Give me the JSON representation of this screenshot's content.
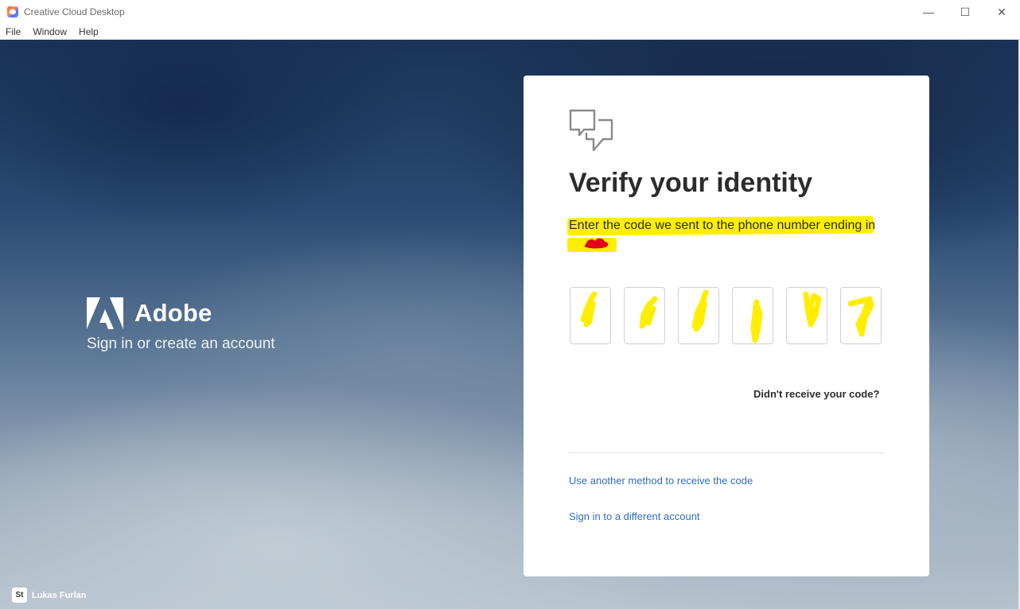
{
  "window": {
    "title": "Creative Cloud Desktop",
    "controls": {
      "minimize": "—",
      "maximize": "☐",
      "close": "✕"
    }
  },
  "menu": [
    "File",
    "Window",
    "Help"
  ],
  "brand": {
    "name": "Adobe",
    "tagline": "Sign in or create an account"
  },
  "user": {
    "badge": "St",
    "name": "Lukas Furlan"
  },
  "card": {
    "icon": "chat-bubbles-icon",
    "title": "Verify your identity",
    "description": "Enter the code we sent to the phone number ending in",
    "code_digits": [
      "",
      "",
      "",
      "",
      "",
      ""
    ],
    "resend_link": "Didn't receive your code?",
    "alt_method_link": "Use another method to receive the code",
    "different_account_link": "Sign in to a different account"
  },
  "colors": {
    "link": "#2d6fc2",
    "highlight": "#ffee00",
    "redaction": "#e3001b",
    "text": "#2c2c2c"
  }
}
